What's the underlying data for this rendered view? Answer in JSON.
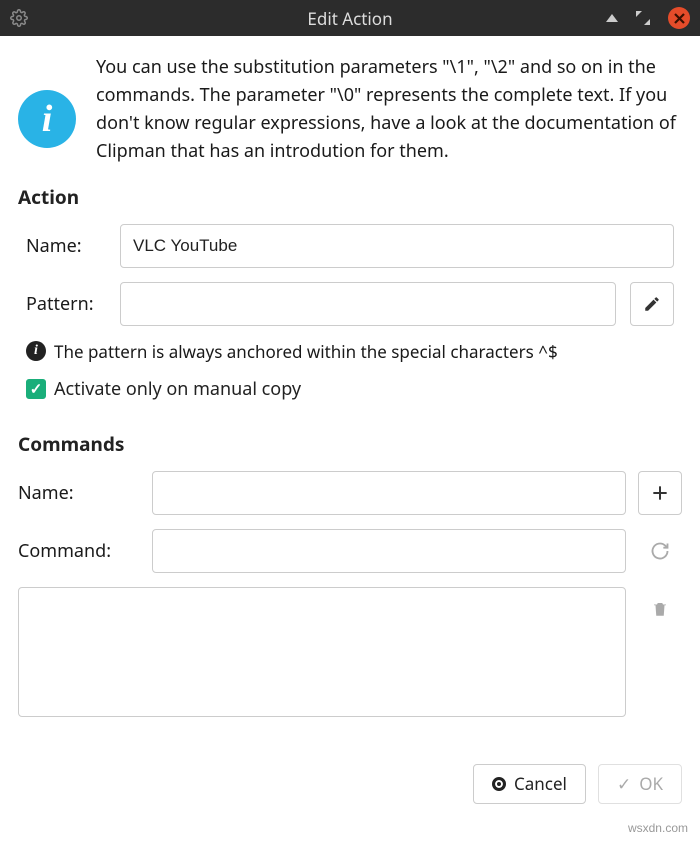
{
  "titlebar": {
    "title": "Edit Action"
  },
  "info": {
    "icon_label": "i",
    "text": "You can use the substitution parameters \"\\1\", \"\\2\" and so on in the commands. The parameter \"\\0\" represents the complete text. If you don't know regular expressions, have a look at the documentation of Clipman that has an introdution for them."
  },
  "action": {
    "section_title": "Action",
    "name_label": "Name:",
    "name_value": "VLC YouTube",
    "pattern_label": "Pattern:",
    "pattern_value": "",
    "hint_text": "The pattern is always anchored within the special characters ^$",
    "checkbox_label": "Activate only on manual copy",
    "checkbox_checked": true
  },
  "commands": {
    "section_title": "Commands",
    "name_label": "Name:",
    "name_value": "",
    "command_label": "Command:",
    "command_value": ""
  },
  "footer": {
    "cancel_label": "Cancel",
    "ok_label": "OK"
  },
  "watermark": "wsxdn.com"
}
